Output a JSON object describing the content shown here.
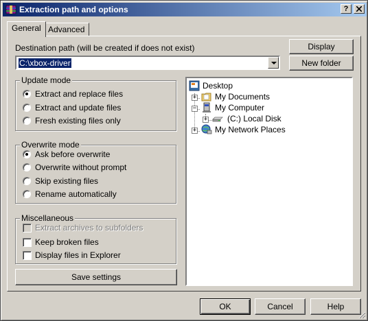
{
  "window": {
    "title": "Extraction path and options",
    "help_btn": "?",
    "close_btn": "X"
  },
  "tabs": [
    {
      "label": "General"
    },
    {
      "label": "Advanced"
    }
  ],
  "destination": {
    "label": "Destination path (will be created if does not exist)",
    "value": "C:\\xbox-driver",
    "display_btn": "Display",
    "new_folder_btn": "New folder"
  },
  "update_mode": {
    "title": "Update mode",
    "options": [
      {
        "label": "Extract and replace files",
        "checked": true
      },
      {
        "label": "Extract and update files",
        "checked": false
      },
      {
        "label": "Fresh existing files only",
        "checked": false
      }
    ]
  },
  "overwrite_mode": {
    "title": "Overwrite mode",
    "options": [
      {
        "label": "Ask before overwrite",
        "checked": true
      },
      {
        "label": "Overwrite without prompt",
        "checked": false
      },
      {
        "label": "Skip existing files",
        "checked": false
      },
      {
        "label": "Rename automatically",
        "checked": false
      }
    ]
  },
  "misc": {
    "title": "Miscellaneous",
    "options": [
      {
        "label": "Extract archives to subfolders",
        "checked": false,
        "disabled": true
      },
      {
        "label": "Keep broken files",
        "checked": false,
        "disabled": false
      },
      {
        "label": "Display files in Explorer",
        "checked": false,
        "disabled": false
      }
    ]
  },
  "save_settings_btn": "Save settings",
  "tree": {
    "desktop": "Desktop",
    "my_documents": "My Documents",
    "my_computer": "My Computer",
    "local_disk": "(C:) Local Disk",
    "network": "My Network Places"
  },
  "footer": {
    "ok": "OK",
    "cancel": "Cancel",
    "help": "Help"
  },
  "colors": {
    "title_start": "#0a246a",
    "title_end": "#a6caf0",
    "face": "#d4d0c8",
    "selection": "#0a246a"
  }
}
